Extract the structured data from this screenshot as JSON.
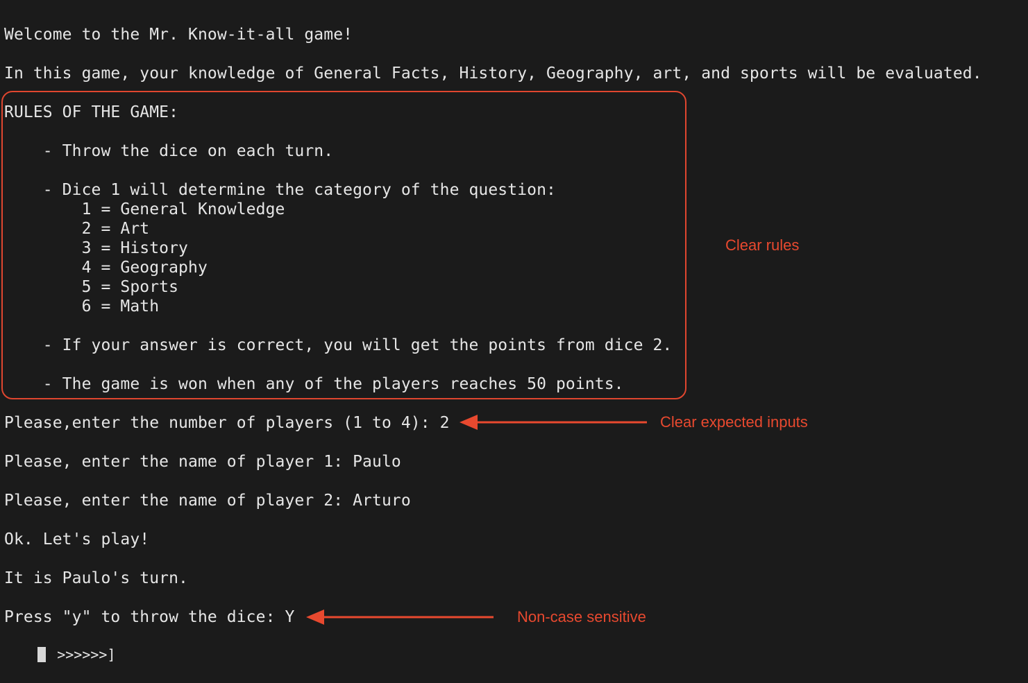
{
  "terminal": {
    "lines": [
      "Welcome to the Mr. Know-it-all game!",
      "In this game, your knowledge of General Facts, History, Geography, art, and sports will be evaluated.",
      "RULES OF THE GAME:",
      "    - Throw the dice on each turn.",
      "    - Dice 1 will determine the category of the question:",
      "        1 = General Knowledge",
      "        2 = Art",
      "        3 = History",
      "        4 = Geography",
      "        5 = Sports",
      "        6 = Math",
      "    - If your answer is correct, you will get the points from dice 2.",
      "    - The game is won when any of the players reaches 50 points.",
      "Please,enter the number of players (1 to 4): 2",
      "Please, enter the name of player 1: Paulo",
      "Please, enter the name of player 2: Arturo",
      "Ok. Let's play!",
      "It is Paulo's turn.",
      "Press \"y\" to throw the dice: Y"
    ],
    "progress_text": " >>>>>>]"
  },
  "annotations": {
    "rules_label": "Clear rules",
    "inputs_label": "Clear expected inputs",
    "case_label": "Non-case sensitive"
  },
  "colors": {
    "background": "#1b1b1b",
    "text": "#e6e6e6",
    "annotation": "#e8492f"
  }
}
